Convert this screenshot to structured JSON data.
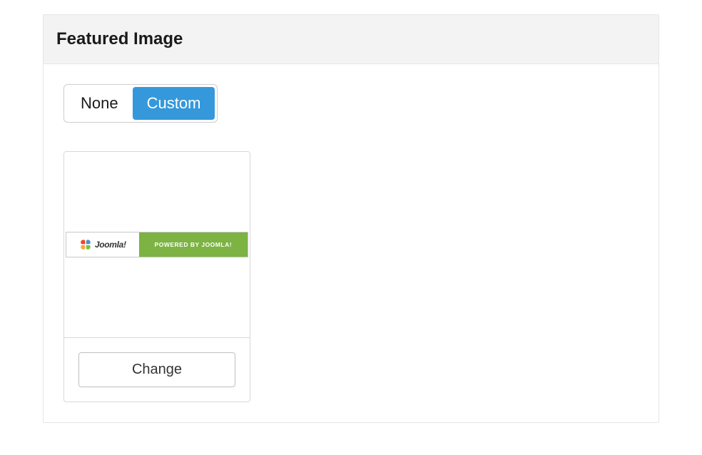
{
  "panel": {
    "title": "Featured Image",
    "toggle": {
      "options": [
        {
          "label": "None",
          "active": false
        },
        {
          "label": "Custom",
          "active": true
        }
      ]
    },
    "image": {
      "logo_text": "Joomla!",
      "powered_text": "POWERED BY JOOMLA!"
    },
    "change_button": "Change"
  }
}
